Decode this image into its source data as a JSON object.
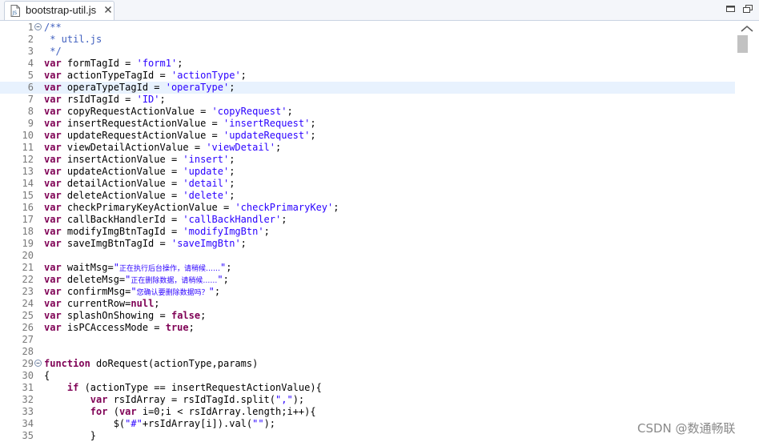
{
  "tab": {
    "title": "bootstrap-util.js",
    "icon": "js-file-icon"
  },
  "window_buttons": [
    "minimize-icon",
    "maximize-icon"
  ],
  "colors": {
    "keyword": "#7f0055",
    "string": "#2a00ff",
    "comment": "#3f5fbf",
    "current_line": "#e8f2fe"
  },
  "current_line": 6,
  "folded_lines": [
    1,
    29
  ],
  "lines": [
    {
      "n": "1",
      "t": [
        [
          "c",
          "/**"
        ]
      ]
    },
    {
      "n": "2",
      "t": [
        [
          "c",
          " * util.js"
        ]
      ]
    },
    {
      "n": "3",
      "t": [
        [
          "c",
          " */"
        ]
      ]
    },
    {
      "n": "4",
      "t": [
        [
          "k",
          "var"
        ],
        [
          "p",
          " formTagId = "
        ],
        [
          "s",
          "'form1'"
        ],
        [
          "p",
          ";"
        ]
      ]
    },
    {
      "n": "5",
      "t": [
        [
          "k",
          "var"
        ],
        [
          "p",
          " actionTypeTagId = "
        ],
        [
          "s",
          "'actionType'"
        ],
        [
          "p",
          ";"
        ]
      ]
    },
    {
      "n": "6",
      "t": [
        [
          "k",
          "var"
        ],
        [
          "p",
          " operaTypeTagId = "
        ],
        [
          "s",
          "'operaType'"
        ],
        [
          "p",
          ";"
        ]
      ]
    },
    {
      "n": "7",
      "t": [
        [
          "k",
          "var"
        ],
        [
          "p",
          " rsIdTagId = "
        ],
        [
          "s",
          "'ID'"
        ],
        [
          "p",
          ";"
        ]
      ]
    },
    {
      "n": "8",
      "t": [
        [
          "k",
          "var"
        ],
        [
          "p",
          " copyRequestActionValue = "
        ],
        [
          "s",
          "'copyRequest'"
        ],
        [
          "p",
          ";"
        ]
      ]
    },
    {
      "n": "9",
      "t": [
        [
          "k",
          "var"
        ],
        [
          "p",
          " insertRequestActionValue = "
        ],
        [
          "s",
          "'insertRequest'"
        ],
        [
          "p",
          ";"
        ]
      ]
    },
    {
      "n": "10",
      "t": [
        [
          "k",
          "var"
        ],
        [
          "p",
          " updateRequestActionValue = "
        ],
        [
          "s",
          "'updateRequest'"
        ],
        [
          "p",
          ";"
        ]
      ]
    },
    {
      "n": "11",
      "t": [
        [
          "k",
          "var"
        ],
        [
          "p",
          " viewDetailActionValue = "
        ],
        [
          "s",
          "'viewDetail'"
        ],
        [
          "p",
          ";"
        ]
      ]
    },
    {
      "n": "12",
      "t": [
        [
          "k",
          "var"
        ],
        [
          "p",
          " insertActionValue = "
        ],
        [
          "s",
          "'insert'"
        ],
        [
          "p",
          ";"
        ]
      ]
    },
    {
      "n": "13",
      "t": [
        [
          "k",
          "var"
        ],
        [
          "p",
          " updateActionValue = "
        ],
        [
          "s",
          "'update'"
        ],
        [
          "p",
          ";"
        ]
      ]
    },
    {
      "n": "14",
      "t": [
        [
          "k",
          "var"
        ],
        [
          "p",
          " detailActionValue = "
        ],
        [
          "s",
          "'detail'"
        ],
        [
          "p",
          ";"
        ]
      ]
    },
    {
      "n": "15",
      "t": [
        [
          "k",
          "var"
        ],
        [
          "p",
          " deleteActionValue = "
        ],
        [
          "s",
          "'delete'"
        ],
        [
          "p",
          ";"
        ]
      ]
    },
    {
      "n": "16",
      "t": [
        [
          "k",
          "var"
        ],
        [
          "p",
          " checkPrimaryKeyActionValue = "
        ],
        [
          "s",
          "'checkPrimaryKey'"
        ],
        [
          "p",
          ";"
        ]
      ]
    },
    {
      "n": "17",
      "t": [
        [
          "k",
          "var"
        ],
        [
          "p",
          " callBackHandlerId = "
        ],
        [
          "s",
          "'callBackHandler'"
        ],
        [
          "p",
          ";"
        ]
      ]
    },
    {
      "n": "18",
      "t": [
        [
          "k",
          "var"
        ],
        [
          "p",
          " modifyImgBtnTagId = "
        ],
        [
          "s",
          "'modifyImgBtn'"
        ],
        [
          "p",
          ";"
        ]
      ]
    },
    {
      "n": "19",
      "t": [
        [
          "k",
          "var"
        ],
        [
          "p",
          " saveImgBtnTagId = "
        ],
        [
          "s",
          "'saveImgBtn'"
        ],
        [
          "p",
          ";"
        ]
      ]
    },
    {
      "n": "20",
      "t": []
    },
    {
      "n": "21",
      "t": [
        [
          "k",
          "var"
        ],
        [
          "p",
          " waitMsg="
        ],
        [
          "s",
          "\""
        ],
        [
          "z",
          "正在执行后台操作，请稍候……"
        ],
        [
          "s",
          "\""
        ],
        [
          "p",
          ";"
        ]
      ]
    },
    {
      "n": "22",
      "t": [
        [
          "k",
          "var"
        ],
        [
          "p",
          " deleteMsg="
        ],
        [
          "s",
          "\""
        ],
        [
          "z",
          "正在删除数据，请稍候……"
        ],
        [
          "s",
          "\""
        ],
        [
          "p",
          ";"
        ]
      ]
    },
    {
      "n": "23",
      "t": [
        [
          "k",
          "var"
        ],
        [
          "p",
          " confirmMsg="
        ],
        [
          "s",
          "\""
        ],
        [
          "z",
          "您确认要删除数据吗？"
        ],
        [
          "s",
          "\""
        ],
        [
          "p",
          ";"
        ]
      ]
    },
    {
      "n": "24",
      "t": [
        [
          "k",
          "var"
        ],
        [
          "p",
          " currentRow="
        ],
        [
          "k",
          "null"
        ],
        [
          "p",
          ";"
        ]
      ]
    },
    {
      "n": "25",
      "t": [
        [
          "k",
          "var"
        ],
        [
          "p",
          " splashOnShowing = "
        ],
        [
          "k",
          "false"
        ],
        [
          "p",
          ";"
        ]
      ]
    },
    {
      "n": "26",
      "t": [
        [
          "k",
          "var"
        ],
        [
          "p",
          " isPCAccessMode = "
        ],
        [
          "k",
          "true"
        ],
        [
          "p",
          ";"
        ]
      ]
    },
    {
      "n": "27",
      "t": []
    },
    {
      "n": "28",
      "t": []
    },
    {
      "n": "29",
      "t": [
        [
          "k",
          "function"
        ],
        [
          "p",
          " doRequest(actionType,params)"
        ]
      ]
    },
    {
      "n": "30",
      "t": [
        [
          "p",
          "{"
        ]
      ]
    },
    {
      "n": "31",
      "t": [
        [
          "p",
          "    "
        ],
        [
          "k",
          "if"
        ],
        [
          "p",
          " (actionType == insertRequestActionValue){"
        ]
      ]
    },
    {
      "n": "32",
      "t": [
        [
          "p",
          "        "
        ],
        [
          "k",
          "var"
        ],
        [
          "p",
          " rsIdArray = rsIdTagId.split("
        ],
        [
          "s",
          "\",\""
        ],
        [
          "p",
          ");"
        ]
      ]
    },
    {
      "n": "33",
      "t": [
        [
          "p",
          "        "
        ],
        [
          "k",
          "for"
        ],
        [
          "p",
          " ("
        ],
        [
          "k",
          "var"
        ],
        [
          "p",
          " i=0;i < rsIdArray.length;i++){"
        ]
      ]
    },
    {
      "n": "34",
      "t": [
        [
          "p",
          "            $("
        ],
        [
          "s",
          "\"#\""
        ],
        [
          "p",
          "+rsIdArray[i]).val("
        ],
        [
          "s",
          "\"\""
        ],
        [
          "p",
          ");"
        ]
      ]
    },
    {
      "n": "35",
      "t": [
        [
          "p",
          "        }"
        ]
      ]
    }
  ],
  "watermark": "CSDN @数通畅联"
}
